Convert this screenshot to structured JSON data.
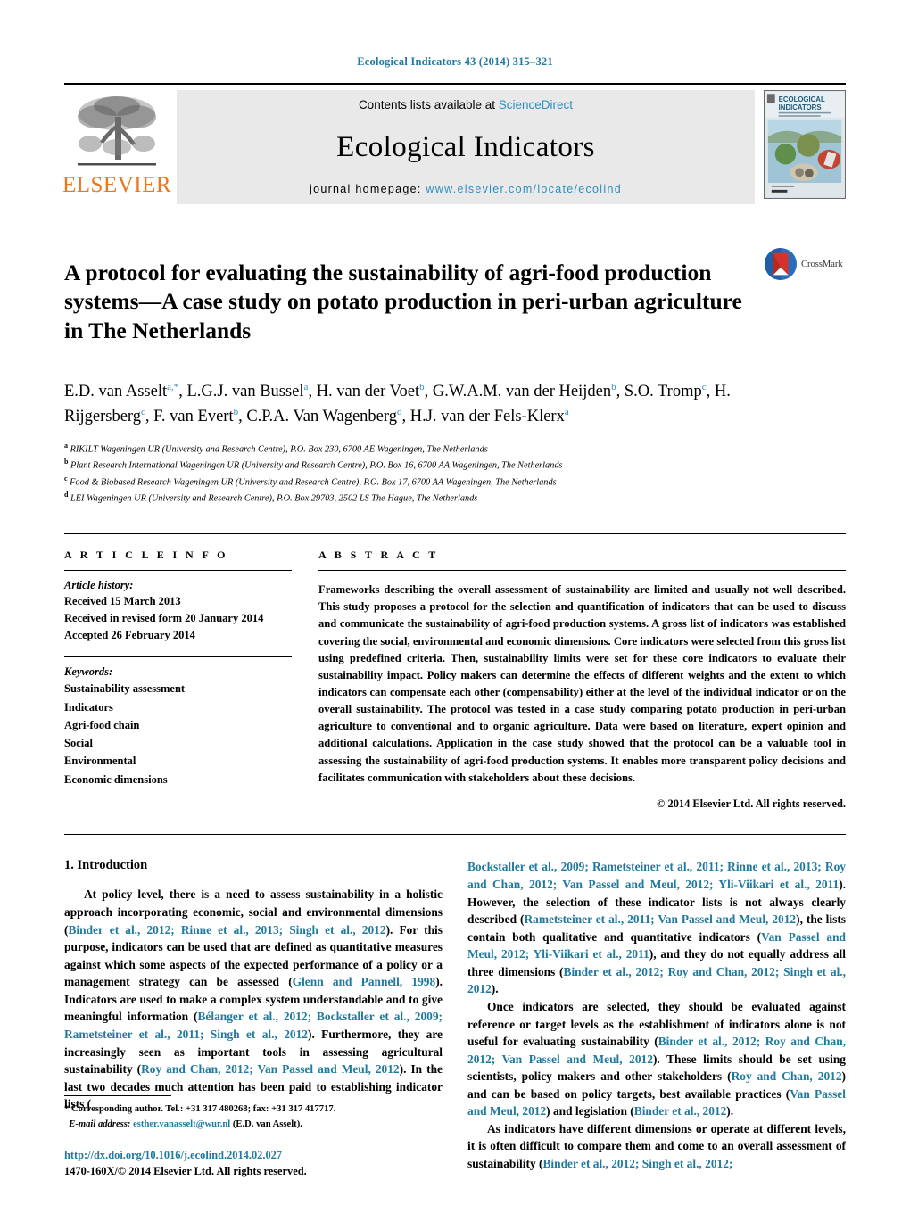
{
  "running_head": "Ecological Indicators 43 (2014) 315–321",
  "masthead": {
    "contents_prefix": "Contents lists available at ",
    "sciencedirect": "ScienceDirect",
    "journal_name": "Ecological Indicators",
    "homepage_prefix": "journal homepage: ",
    "homepage_url": "www.elsevier.com/locate/ecolind",
    "publisher": "ELSEVIER",
    "cover_title_line1": "ECOLOGICAL",
    "cover_title_line2": "INDICATORS",
    "accent_blue": "#2d8fc0",
    "elsevier_orange": "#E87722"
  },
  "article": {
    "title": "A protocol for evaluating the sustainability of agri-food production systems—A case study on potato production in peri-urban agriculture in The Netherlands",
    "crossmark_label": "CrossMark"
  },
  "authors": [
    {
      "name": "E.D. van Asselt",
      "marks": "a,*"
    },
    {
      "name": "L.G.J. van Bussel",
      "marks": "a"
    },
    {
      "name": "H. van der Voet",
      "marks": "b"
    },
    {
      "name": "G.W.A.M. van der Heijden",
      "marks": "b"
    },
    {
      "name": "S.O. Tromp",
      "marks": "c"
    },
    {
      "name": "H. Rijgersberg",
      "marks": "c"
    },
    {
      "name": "F. van Evert",
      "marks": "b"
    },
    {
      "name": "C.P.A. Van Wagenberg",
      "marks": "d"
    },
    {
      "name": "H.J. van der Fels-Klerx",
      "marks": "a"
    }
  ],
  "affiliations": [
    {
      "mark": "a",
      "text": "RIKILT Wageningen UR (University and Research Centre), P.O. Box 230, 6700 AE Wageningen, The Netherlands"
    },
    {
      "mark": "b",
      "text": "Plant Research International Wageningen UR (University and Research Centre), P.O. Box 16, 6700 AA Wageningen, The Netherlands"
    },
    {
      "mark": "c",
      "text": "Food & Biobased Research Wageningen UR (University and Research Centre), P.O. Box 17, 6700 AA Wageningen, The Netherlands"
    },
    {
      "mark": "d",
      "text": "LEI Wageningen UR (University and Research Centre), P.O. Box 29703, 2502 LS The Hague, The Netherlands"
    }
  ],
  "article_info": {
    "heading": "A R T I C L E   I N F O",
    "history_label": "Article history:",
    "history": [
      "Received 15 March 2013",
      "Received in revised form 20 January 2014",
      "Accepted 26 February 2014"
    ],
    "keywords_label": "Keywords:",
    "keywords": [
      "Sustainability assessment",
      "Indicators",
      "Agri-food chain",
      "Social",
      "Environmental",
      "Economic dimensions"
    ]
  },
  "abstract": {
    "heading": "A B S T R A C T",
    "text": "Frameworks describing the overall assessment of sustainability are limited and usually not well described. This study proposes a protocol for the selection and quantification of indicators that can be used to discuss and communicate the sustainability of agri-food production systems. A gross list of indicators was established covering the social, environmental and economic dimensions. Core indicators were selected from this gross list using predefined criteria. Then, sustainability limits were set for these core indicators to evaluate their sustainability impact. Policy makers can determine the effects of different weights and the extent to which indicators can compensate each other (compensability) either at the level of the individual indicator or on the overall sustainability. The protocol was tested in a case study comparing potato production in peri-urban agriculture to conventional and to organic agriculture. Data were based on literature, expert opinion and additional calculations. Application in the case study showed that the protocol can be a valuable tool in assessing the sustainability of agri-food production systems. It enables more transparent policy decisions and facilitates communication with stakeholders about these decisions.",
    "copyright": "© 2014 Elsevier Ltd. All rights reserved."
  },
  "body": {
    "section_heading": "1. Introduction",
    "left_paragraph_1_a": "At policy level, there is a need to assess sustainability in a holistic approach incorporating economic, social and environmental dimensions (",
    "left_cite_1": "Binder et al., 2012; Rinne et al., 2013; Singh et al., 2012",
    "left_paragraph_1_b": "). For this purpose, indicators can be used that are defined as quantitative measures against which some aspects of the expected performance of a policy or a management strategy can be assessed (",
    "left_cite_2": "Glenn and Pannell, 1998",
    "left_paragraph_1_c": "). Indicators are used to make a complex system understandable and to give meaningful information (",
    "left_cite_3": "Bélanger et al., 2012; Bockstaller et al., 2009; Rametsteiner et al., 2011; Singh et al., 2012",
    "left_paragraph_1_d": "). Furthermore, they are increasingly seen as important tools in assessing agricultural sustainability (",
    "left_cite_4": "Roy and Chan, 2012; Van Passel and Meul, 2012",
    "left_paragraph_1_e": "). In the last two decades much attention has been paid to establishing indicator lists (",
    "right_cite_1": "Bockstaller et al., 2009; Rametsteiner et al., 2011; Rinne et al., 2013; Roy and Chan, 2012; Van Passel and Meul, 2012; Yli-Viikari et al., 2011",
    "right_paragraph_1_b": "). However, the selection of these indicator lists is not always clearly described (",
    "right_cite_2": "Rametsteiner et al., 2011; Van Passel and Meul, 2012",
    "right_paragraph_1_c": "), the lists contain both qualitative and quantitative indicators (",
    "right_cite_3": "Van Passel and Meul, 2012; Yli-Viikari et al., 2011",
    "right_paragraph_1_d": "), and they do not equally address all three dimensions (",
    "right_cite_4": "Binder et al., 2012; Roy and Chan, 2012; Singh et al., 2012",
    "right_paragraph_1_e": ").",
    "right_paragraph_2_a": "Once indicators are selected, they should be evaluated against reference or target levels as the establishment of indicators alone is not useful for evaluating sustainability (",
    "right_cite_5": "Binder et al., 2012; Roy and Chan, 2012; Van Passel and Meul, 2012",
    "right_paragraph_2_b": "). These limits should be set using scientists, policy makers and other stakeholders (",
    "right_cite_6": "Roy and Chan, 2012",
    "right_paragraph_2_c": ") and can be based on policy targets, best available practices (",
    "right_cite_7": "Van Passel and Meul, 2012",
    "right_paragraph_2_d": ") and legislation (",
    "right_cite_8": "Binder et al., 2012",
    "right_paragraph_2_e": ").",
    "right_paragraph_3_a": "As indicators have different dimensions or operate at different levels, it is often difficult to compare them and come to an overall assessment of sustainability (",
    "right_cite_9": "Binder et al., 2012; Singh et al., 2012;",
    "right_paragraph_3_b": ""
  },
  "footnote": {
    "star": "*",
    "corresponding": "Corresponding author. Tel.: +31 317 480268; fax: +31 317 417717.",
    "email_label": "E-mail address:",
    "email": "esther.vanasselt@wur.nl",
    "email_suffix": "(E.D. van Asselt)."
  },
  "footer": {
    "doi": "http://dx.doi.org/10.1016/j.ecolind.2014.02.027",
    "issn": "1470-160X/© 2014 Elsevier Ltd. All rights reserved."
  }
}
